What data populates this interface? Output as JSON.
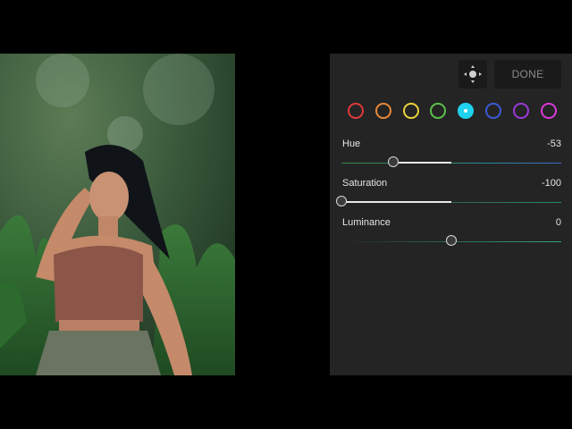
{
  "photo": {
    "description_icon": "photo-preview"
  },
  "toolbar": {
    "target_icon": "target-adjust-icon",
    "done_label": "DONE"
  },
  "colors": [
    {
      "name": "red",
      "hex": "#e03a3a"
    },
    {
      "name": "orange",
      "hex": "#e8883a"
    },
    {
      "name": "yellow",
      "hex": "#e8d23a"
    },
    {
      "name": "green",
      "hex": "#5cc04a"
    },
    {
      "name": "aqua",
      "hex": "#1fd2f0",
      "selected": true
    },
    {
      "name": "blue",
      "hex": "#3a5ad8"
    },
    {
      "name": "purple",
      "hex": "#9a3ad8"
    },
    {
      "name": "magenta",
      "hex": "#d83ad8"
    }
  ],
  "sliders": [
    {
      "label": "Hue",
      "value": "-53",
      "numeric": -53,
      "min": -100,
      "max": 100
    },
    {
      "label": "Saturation",
      "value": "-100",
      "numeric": -100,
      "min": -100,
      "max": 100
    },
    {
      "label": "Luminance",
      "value": "0",
      "numeric": 0,
      "min": -100,
      "max": 100
    }
  ]
}
